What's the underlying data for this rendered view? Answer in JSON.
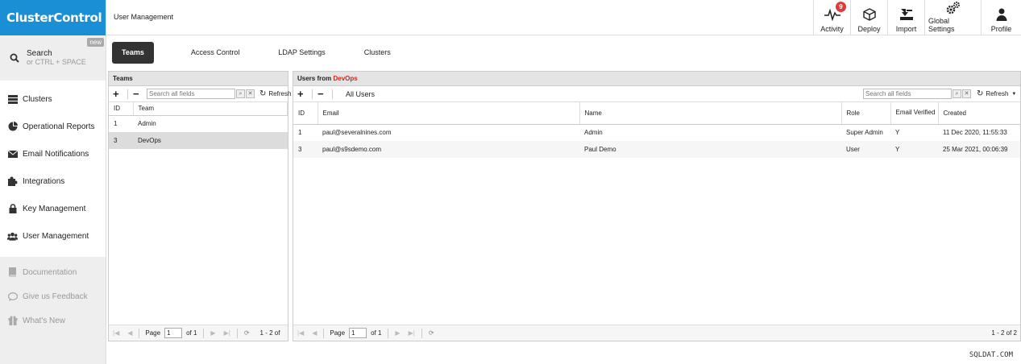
{
  "app": {
    "logo": "ClusterControl",
    "page_title": "User Management"
  },
  "search": {
    "label": "Search",
    "hint": "or CTRL + SPACE",
    "badge": "new"
  },
  "sidebar": {
    "items": [
      {
        "label": "Clusters",
        "icon": "server-icon"
      },
      {
        "label": "Operational Reports",
        "icon": "pie-chart-icon"
      },
      {
        "label": "Email Notifications",
        "icon": "envelope-icon"
      },
      {
        "label": "Integrations",
        "icon": "puzzle-icon"
      },
      {
        "label": "Key Management",
        "icon": "lock-icon"
      },
      {
        "label": "User Management",
        "icon": "users-icon"
      }
    ],
    "secondary": [
      {
        "label": "Documentation",
        "icon": "book-icon"
      },
      {
        "label": "Give us Feedback",
        "icon": "comment-icon"
      },
      {
        "label": "What's New",
        "icon": "gift-icon"
      }
    ]
  },
  "topbar": {
    "buttons": [
      {
        "label": "Activity",
        "icon": "pulse-icon",
        "badge": "9"
      },
      {
        "label": "Deploy",
        "icon": "cube-icon"
      },
      {
        "label": "Import",
        "icon": "import-icon"
      },
      {
        "label": "Global Settings",
        "icon": "gears-icon"
      },
      {
        "label": "Profile",
        "icon": "user-icon"
      }
    ]
  },
  "tabs": [
    "Teams",
    "Access Control",
    "LDAP Settings",
    "Clusters"
  ],
  "teams": {
    "title": "Teams",
    "search_placeholder": "Search all fields",
    "refresh": "Refresh",
    "columns": [
      "ID",
      "Team"
    ],
    "rows": [
      {
        "id": "1",
        "team": "Admin"
      },
      {
        "id": "3",
        "team": "DevOps"
      }
    ],
    "pager": {
      "page_label": "Page",
      "page": "1",
      "of": "of 1",
      "range": "1 - 2 of"
    }
  },
  "users": {
    "title_prefix": "Users from",
    "team": "DevOps",
    "all_users": "All Users",
    "search_placeholder": "Search all fields",
    "refresh": "Refresh",
    "columns": [
      "ID",
      "Email",
      "Name",
      "Role",
      "Email Verified",
      "Created"
    ],
    "rows": [
      {
        "id": "1",
        "email": "paul@severalnines.com",
        "name": "Admin",
        "role": "Super Admin",
        "verified": "Y",
        "created": "11 Dec 2020, 11:55:33"
      },
      {
        "id": "3",
        "email": "paul@s9sdemo.com",
        "name": "Paul Demo",
        "role": "User",
        "verified": "Y",
        "created": "25 Mar 2021, 00:06:39"
      }
    ],
    "pager": {
      "page_label": "Page",
      "page": "1",
      "of": "of 1",
      "range": "1 - 2 of 2"
    }
  },
  "watermark": "SQLDAT.COM",
  "colors": {
    "brand": "#1a8fd5",
    "badge": "#e23a3a",
    "team_highlight": "#c8261b"
  }
}
